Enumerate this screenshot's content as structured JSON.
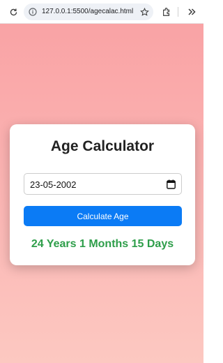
{
  "browser": {
    "url": "127.0.0.1:5500/agecalac.html",
    "icons": {
      "reload": "reload-icon",
      "site_info": "site-info-icon",
      "bookmark": "star-icon",
      "extensions": "puzzle-icon",
      "more": "chevron-double-right-icon"
    }
  },
  "page": {
    "background_top": "#f9a3a5",
    "background_bottom": "#fcc8c1"
  },
  "card": {
    "title": "Age Calculator",
    "date_value": "23-05-2002",
    "button_label": "Calculate Age",
    "result": "24 Years 1 Months 15 Days",
    "button_color": "#0b7bf5",
    "result_color": "#2e9e4a"
  }
}
